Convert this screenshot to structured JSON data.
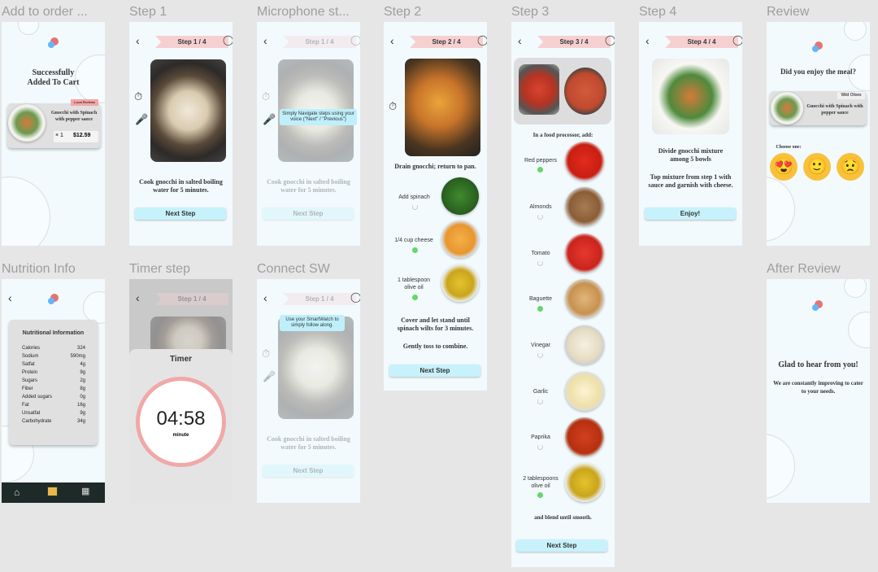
{
  "labels": [
    "Add to order ...",
    "Step 1",
    "Microphone st...",
    "Step 2",
    "Step 3",
    "Step 4",
    "Review",
    "Nutrition Info",
    "Timer step",
    "Connect SW",
    "After Review"
  ],
  "cart": {
    "title": "Successfully Added To Cart",
    "badge": "Local Reviews",
    "item": "Gnocchi with Spinach with pepper sauce",
    "qty": "× 1",
    "price": "$12.59"
  },
  "step_banner": [
    "Step 1 / 4",
    "Step 2 / 4",
    "Step 3 / 4",
    "Step 4 / 4"
  ],
  "step1": {
    "text": "Cook gnocchi in salted boiling water for 5 minutes.",
    "next": "Next Step"
  },
  "mic": {
    "tip": "Simply Navigate steps using your voice (\"Next\" / \"Previous\")"
  },
  "step2": {
    "line1": "Drain gnocchi; return to pan.",
    "items": [
      "Add spinach",
      "1/4 cup cheese",
      "1 tablespoon olive oil"
    ],
    "line2": "Cover and let stand until spinach wilts for 3 minutes.",
    "line3": "Gently toss to combine."
  },
  "step3": {
    "intro": "In a food processor, add:",
    "items": [
      "Red peppers",
      "Almonds",
      "Tomato",
      "Baguette",
      "Vinegar",
      "Garlic",
      "Paprika",
      "2 tablespoons olive oil"
    ],
    "outro": "and blend until smooth."
  },
  "step4": {
    "line1": "Divide gnocchi mixture among 5 bowls",
    "line2": "Top mixture from step 1 with sauce and garnish with cheese.",
    "enjoy": "Enjoy!"
  },
  "review": {
    "question": "Did you enjoy the meal?",
    "badge": "Wild Olives",
    "item": "Gnocchi with Spinach with pepper sauce",
    "choose": "Choose one:"
  },
  "nutrition": {
    "title": "Nutritional Information",
    "rows": [
      [
        "Calories",
        "324"
      ],
      [
        "Sodium",
        "590mg"
      ],
      [
        "Satfat",
        "4g"
      ],
      [
        "Protein",
        "9g"
      ],
      [
        "Sugars",
        "2g"
      ],
      [
        "Fiber",
        "8g"
      ],
      [
        "Added sugars",
        "0g"
      ],
      [
        "Fat",
        "16g"
      ],
      [
        "Unsatfat",
        "9g"
      ],
      [
        "Carbohydrate",
        "34g"
      ]
    ]
  },
  "timer": {
    "title": "Timer",
    "time": "04:58",
    "unit": "minute"
  },
  "sw": {
    "tip": "Use your SmartWatch to simply follow along."
  },
  "after": {
    "title": "Glad to hear from you!",
    "text": "We are constantly improving to cater to your needs."
  },
  "icons": {
    "back": "chevron-left-icon",
    "timer": "stopwatch-icon",
    "mic": "microphone-icon",
    "watch": "smartwatch-icon",
    "home": "home-icon",
    "menu": "menu-icon",
    "bill": "receipt-icon"
  },
  "colors": {
    "accent": "#c7f2fb",
    "banner": "#f6d0d0",
    "check": "#65d66b",
    "timer_ring": "#f0a8a8",
    "nav_bg": "#1e2a28"
  }
}
